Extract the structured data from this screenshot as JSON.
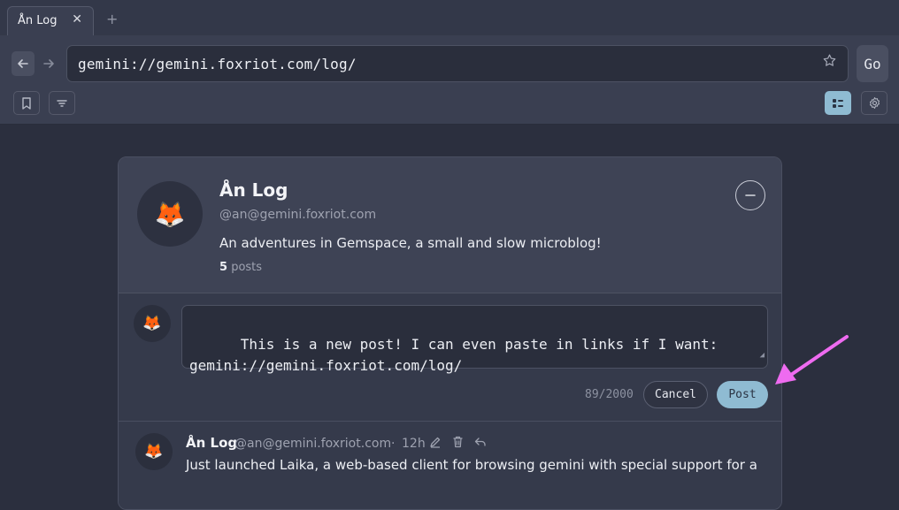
{
  "browser": {
    "tab_title": "Ån Log",
    "tab_close": "✕",
    "new_tab": "+",
    "back_icon": "arrow-left",
    "forward_icon": "arrow-right",
    "url": "gemini://gemini.foxriot.com/log/",
    "go_label": "Go"
  },
  "profile": {
    "avatar": "🦊",
    "name": "Ån Log",
    "handle": "@an@gemini.foxriot.com",
    "description": "An adventures in Gemspace, a small and slow microblog!",
    "post_count": "5",
    "post_count_label": "posts"
  },
  "compose": {
    "avatar": "🦊",
    "text": "This is a new post! I can even paste in links if I want:\ngemini://gemini.foxriot.com/log/",
    "char_count": "89/2000",
    "cancel_label": "Cancel",
    "post_label": "Post"
  },
  "feed": [
    {
      "avatar": "🦊",
      "author": "Ån Log",
      "handle": "@an@gemini.foxriot.com",
      "separator": "·",
      "time": "12h",
      "body": "Just launched Laika, a web-based client for browsing gemini with special support for a"
    }
  ],
  "colors": {
    "accent": "#8fbbd2",
    "annotation_arrow": "#ee6bf0"
  }
}
